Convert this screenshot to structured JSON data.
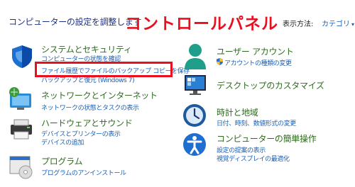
{
  "header": {
    "title": "コンピューターの設定を調整します",
    "overlay_title": "コントロールパネル",
    "view_by_label": "表示方法:",
    "view_by_value": "カテゴリ"
  },
  "left_categories": [
    {
      "title": "システムとセキュリティ",
      "links": [
        "コンピューターの状態を確認",
        "ファイル履歴でファイルのバックアップ コピーを保存",
        "バックアップと復元 (Windows 7)"
      ]
    },
    {
      "title": "ネットワークとインターネット",
      "links": [
        "ネットワークの状態とタスクの表示"
      ]
    },
    {
      "title": "ハードウェアとサウンド",
      "links": [
        "デバイスとプリンターの表示",
        "デバイスの追加"
      ]
    },
    {
      "title": "プログラム",
      "links": [
        "プログラムのアンインストール"
      ]
    }
  ],
  "right_categories": [
    {
      "title": "ユーザー アカウント",
      "links": [
        "アカウントの種類の変更"
      ]
    },
    {
      "title": "デスクトップのカスタマイズ",
      "links": []
    },
    {
      "title": "時計と地域",
      "links": [
        "日付、時刻、数値形式の変更"
      ]
    },
    {
      "title": "コンピューターの簡単操作",
      "links": [
        "設定の提案の表示",
        "視覚ディスプレイの最適化"
      ]
    }
  ],
  "colors": {
    "category_title": "#2e6b1f",
    "link": "#1a5fb4",
    "highlight": "#e8101e"
  }
}
